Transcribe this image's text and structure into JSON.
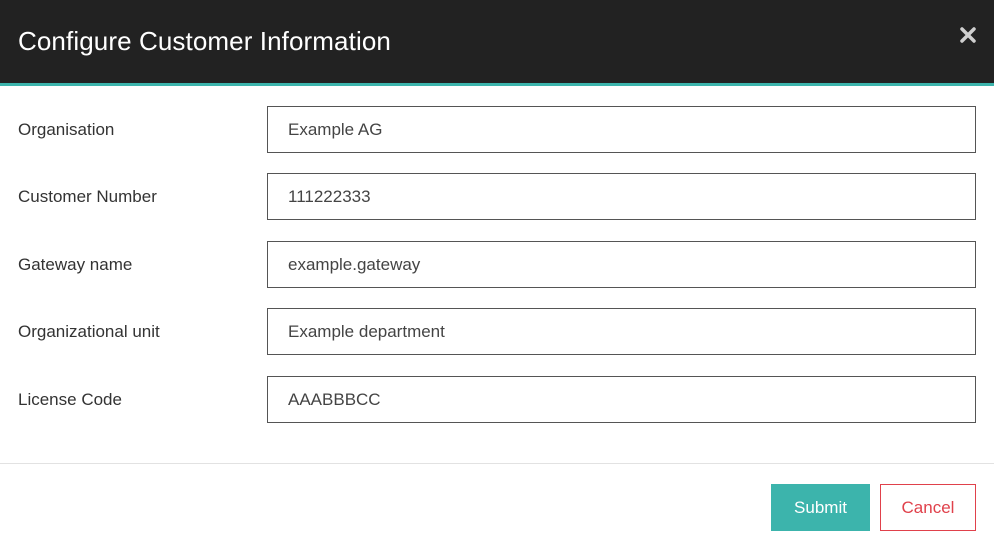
{
  "dialog": {
    "title": "Configure Customer Information",
    "close_icon": "close-icon"
  },
  "form": {
    "fields": [
      {
        "label": "Organisation",
        "value": "Example AG"
      },
      {
        "label": "Customer Number",
        "value": "111222333"
      },
      {
        "label": "Gateway name",
        "value": "example.gateway"
      },
      {
        "label": "Organizational unit",
        "value": "Example department"
      },
      {
        "label": "License Code",
        "value": "AAABBBCC"
      }
    ]
  },
  "footer": {
    "submit_label": "Submit",
    "cancel_label": "Cancel"
  },
  "colors": {
    "header_bg": "#222222",
    "accent": "#3cb4ac",
    "cancel": "#e0414b"
  }
}
